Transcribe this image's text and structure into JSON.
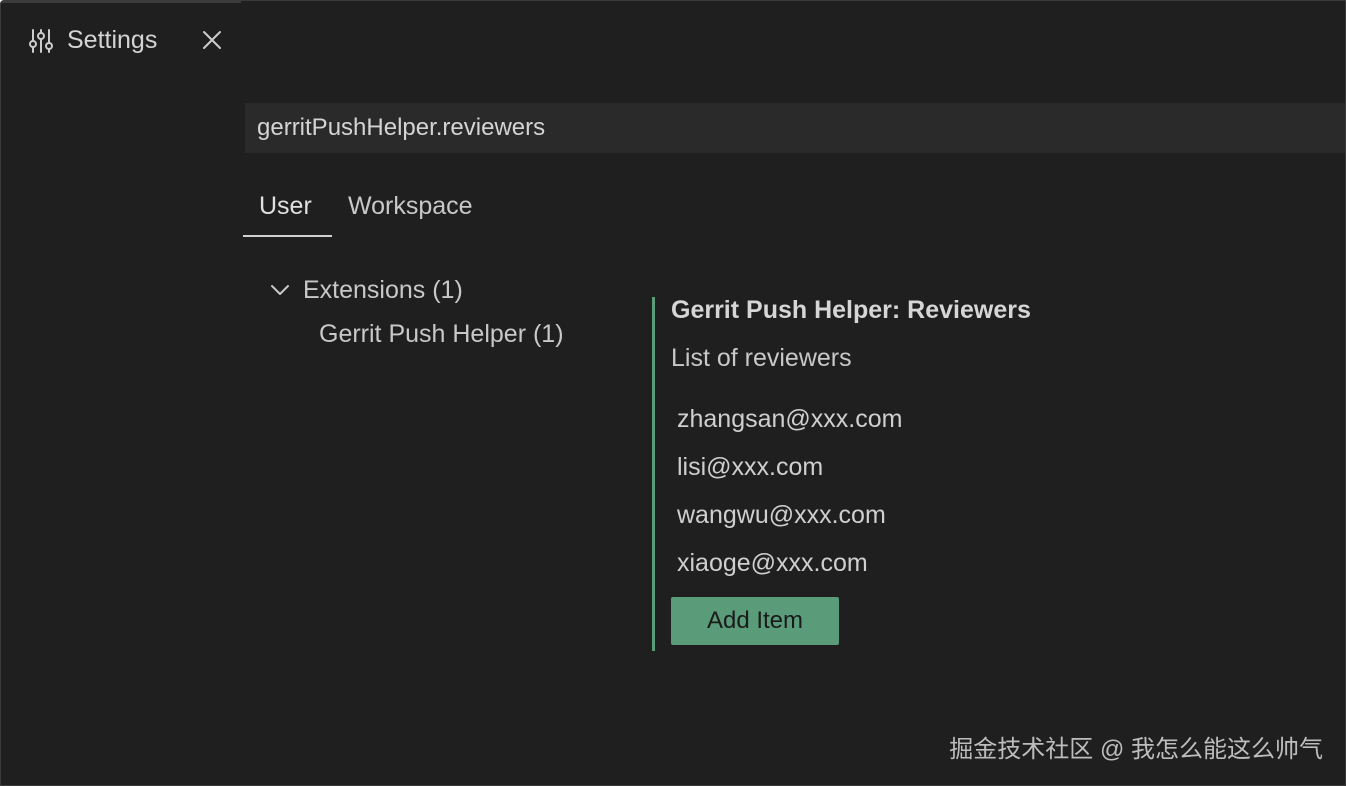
{
  "tab": {
    "title": "Settings",
    "icon": "settings-sliders-icon",
    "close_icon": "close-icon"
  },
  "search": {
    "value": "gerritPushHelper.reviewers"
  },
  "scope_tabs": [
    {
      "label": "User",
      "active": true
    },
    {
      "label": "Workspace",
      "active": false
    }
  ],
  "tree": {
    "extensions_label": "Extensions (1)",
    "gerrit_label": "Gerrit Push Helper (1)"
  },
  "setting": {
    "title": "Gerrit Push Helper: Reviewers",
    "description": "List of reviewers",
    "items": [
      "zhangsan@xxx.com",
      "lisi@xxx.com",
      "wangwu@xxx.com",
      "xiaoge@xxx.com"
    ],
    "add_button_label": "Add Item"
  },
  "watermark": "掘金技术社区 @ 我怎么能这么帅气",
  "colors": {
    "background": "#1f1f1f",
    "accent": "#5a9c7a",
    "search_bg": "#2a2a2a",
    "text": "#cccccc"
  }
}
